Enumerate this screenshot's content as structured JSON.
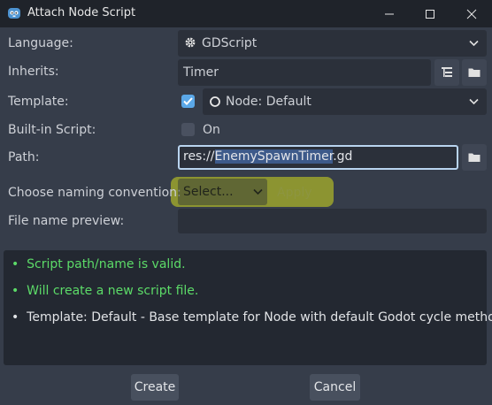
{
  "window": {
    "title": "Attach Node Script"
  },
  "form": {
    "language": {
      "label": "Language:",
      "value": "GDScript"
    },
    "inherits": {
      "label": "Inherits:",
      "value": "Timer"
    },
    "template": {
      "label": "Template:",
      "value": "Node: Default",
      "checked": true
    },
    "builtin": {
      "label": "Built-in Script:",
      "value": "On",
      "checked": false
    },
    "path": {
      "label": "Path:",
      "prefix": "res://",
      "selected": "EnemySpawnTimer",
      "suffix": ".gd"
    },
    "naming": {
      "label": "Choose naming convention:",
      "select": "Select...",
      "apply": "Apply"
    },
    "preview": {
      "label": "File name preview:",
      "value": ""
    }
  },
  "messages": [
    {
      "text": "Script path/name is valid.",
      "status": "ok"
    },
    {
      "text": "Will create a new script file.",
      "status": "ok"
    },
    {
      "text": "Template: Default - Base template for Node with default Godot cycle methods",
      "status": "neutral"
    }
  ],
  "buttons": {
    "create": "Create",
    "cancel": "Cancel"
  },
  "colors": {
    "background": "#363d4a",
    "titlebar": "#1f232a",
    "field": "#2b303a",
    "accent": "#5ba8e8",
    "valid": "#5cdb68",
    "highlight": "#d4dc1e"
  }
}
